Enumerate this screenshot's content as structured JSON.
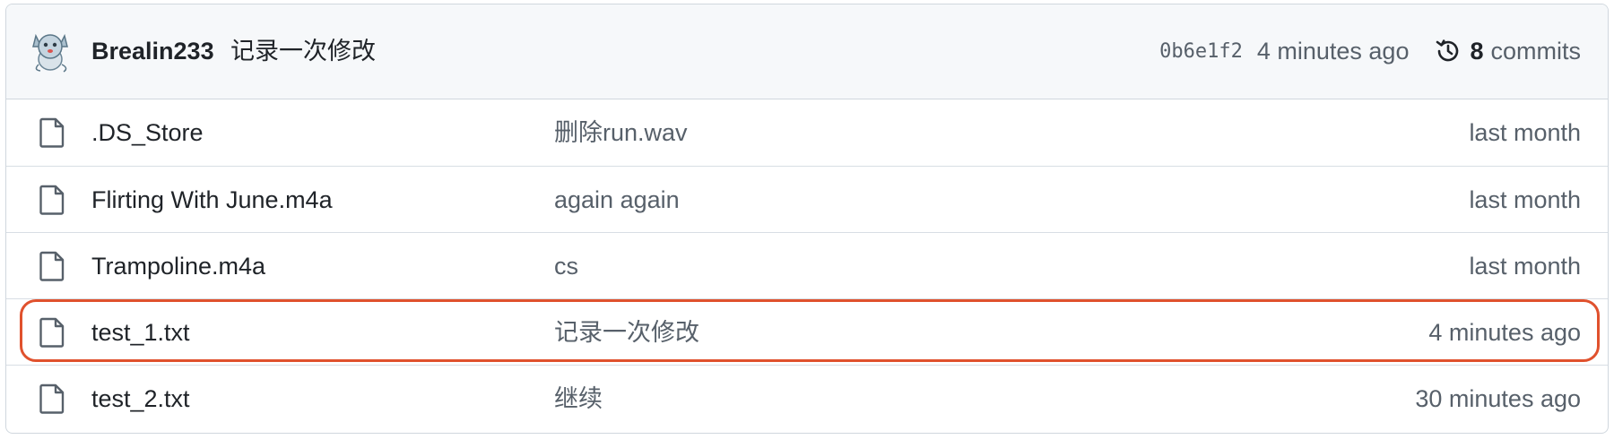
{
  "latest_commit": {
    "author": "Brealin233",
    "message": "记录一次修改",
    "hash": "0b6e1f2",
    "age": "4 minutes ago",
    "commits_count": "8",
    "commits_label": "commits"
  },
  "files": [
    {
      "name": ".DS_Store",
      "message": "删除run.wav",
      "time": "last month"
    },
    {
      "name": "Flirting With June.m4a",
      "message": "again again",
      "time": "last month"
    },
    {
      "name": "Trampoline.m4a",
      "message": "cs",
      "time": "last month"
    },
    {
      "name": "test_1.txt",
      "message": "记录一次修改",
      "time": "4 minutes ago"
    },
    {
      "name": "test_2.txt",
      "message": "继续",
      "time": "30 minutes ago"
    }
  ],
  "highlighted_file": "test_1.txt",
  "colors": {
    "header_bg": "#f6f8fa",
    "border": "#d0d7de",
    "muted_text": "#57606a",
    "highlight": "#e0512d"
  },
  "icons": {
    "avatar": "cat-avatar",
    "history": "history-icon",
    "file": "file-icon"
  }
}
